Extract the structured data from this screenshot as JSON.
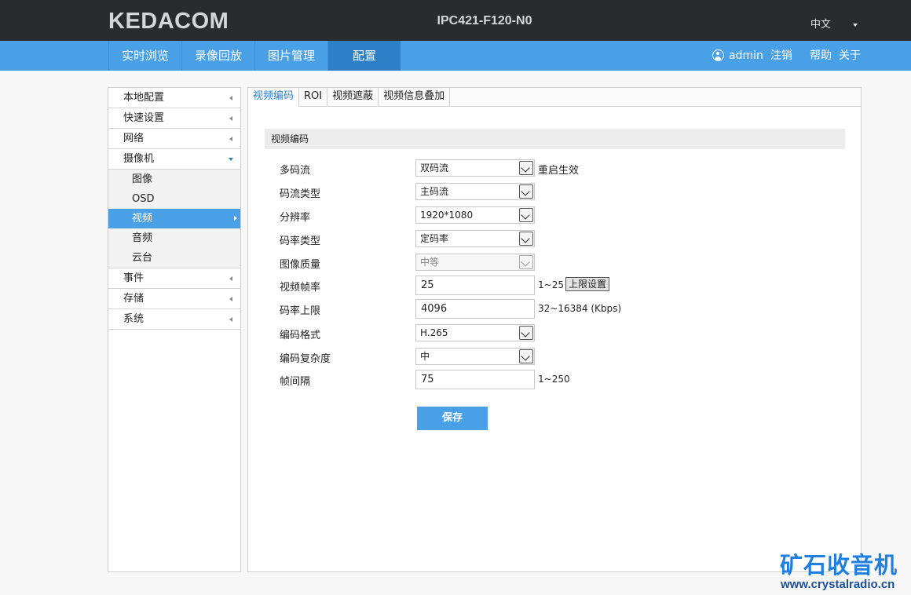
{
  "header": {
    "logo": "KEDACOM",
    "model": "IPC421-F120-N0",
    "language": "中文"
  },
  "nav": {
    "tabs": [
      {
        "label": "实时浏览"
      },
      {
        "label": "录像回放"
      },
      {
        "label": "图片管理"
      },
      {
        "label": "配置"
      }
    ],
    "active_tab": "配置",
    "user": "admin",
    "logout": "注销",
    "help": "帮助",
    "about": "关于"
  },
  "sidebar": {
    "items": [
      {
        "label": "本地配置"
      },
      {
        "label": "快速设置"
      },
      {
        "label": "网络"
      },
      {
        "label": "摄像机"
      },
      {
        "label": "事件"
      },
      {
        "label": "存储"
      },
      {
        "label": "系统"
      }
    ],
    "camera_sub": [
      {
        "label": "图像"
      },
      {
        "label": "OSD"
      },
      {
        "label": "视频"
      },
      {
        "label": "音频"
      },
      {
        "label": "云台"
      }
    ],
    "active_sub": "视频"
  },
  "tabs": [
    {
      "label": "视频编码"
    },
    {
      "label": "ROI"
    },
    {
      "label": "视频遮蔽"
    },
    {
      "label": "视频信息叠加"
    }
  ],
  "section_title": "视频编码",
  "form": {
    "multi_stream": {
      "label": "多码流",
      "value": "双码流",
      "note": "重启生效"
    },
    "stream_type": {
      "label": "码流类型",
      "value": "主码流"
    },
    "resolution": {
      "label": "分辨率",
      "value": "1920*1080"
    },
    "bitrate_type": {
      "label": "码率类型",
      "value": "定码率"
    },
    "image_quality": {
      "label": "图像质量",
      "value": "中等"
    },
    "frame_rate": {
      "label": "视频帧率",
      "value": "25",
      "note": "1~25",
      "button": "上限设置"
    },
    "bitrate_limit": {
      "label": "码率上限",
      "value": "4096",
      "note": "32~16384 (Kbps)"
    },
    "encoding": {
      "label": "编码格式",
      "value": "H.265"
    },
    "complexity": {
      "label": "编码复杂度",
      "value": "中"
    },
    "iframe_interval": {
      "label": "帧间隔",
      "value": "75",
      "note": "1~250"
    },
    "save": "保存"
  },
  "watermark": {
    "title": "矿石收音机",
    "url": "www.crystalradio.cn"
  }
}
